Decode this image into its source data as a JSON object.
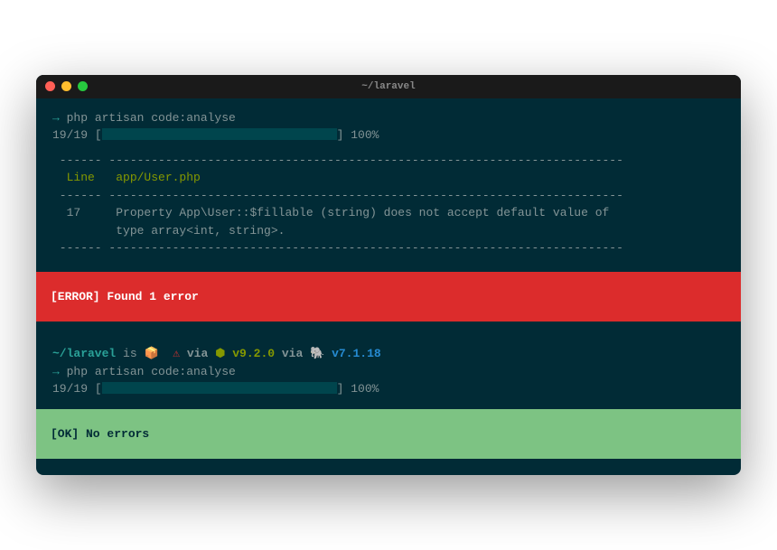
{
  "window": {
    "title": "~/laravel"
  },
  "run1": {
    "command": "php artisan code:analyse",
    "progress": "19/19",
    "percent": "100%",
    "dashLine": " ------ ------------------------------------------------------------------------- ",
    "headerLine": "  Line   app/User.php                                                             ",
    "errorLineNum": "  17",
    "errorMsg1": "     Property App\\User::$fillable (string) does not accept default value of ",
    "errorMsg2": "         type array<int, string>.                                                 "
  },
  "errorBanner": "[ERROR] Found 1 error",
  "prompt2": {
    "path": "~/laravel",
    "is": " is ",
    "via": "via ",
    "nodeVersion": "v9.2.0",
    "via2": " via ",
    "phpVersion": "v7.1.18"
  },
  "run2": {
    "command": "php artisan code:analyse",
    "progress": "19/19",
    "percent": "100%"
  },
  "okBanner": "[OK] No errors"
}
